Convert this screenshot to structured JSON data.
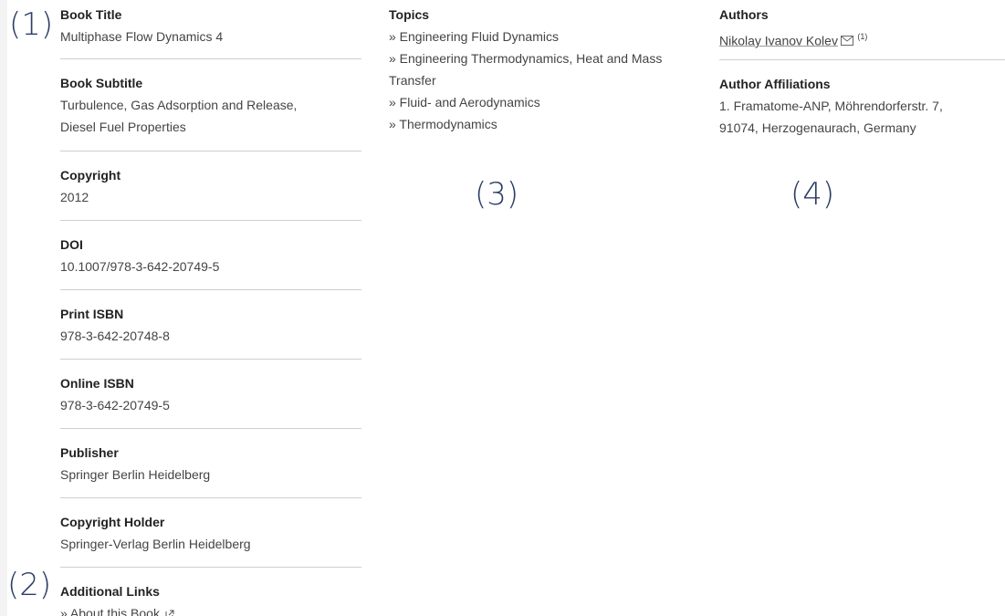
{
  "annotations": [
    "(1)",
    "(2)",
    "(3)",
    "(4)"
  ],
  "left": {
    "fields": [
      {
        "label": "Book Title",
        "value": "Multiphase Flow Dynamics 4"
      },
      {
        "label": "Book Subtitle",
        "value": "Turbulence, Gas Adsorption and Release, Diesel Fuel Properties"
      },
      {
        "label": "Copyright",
        "value": "2012"
      },
      {
        "label": "DOI",
        "value": "10.1007/978-3-642-20749-5"
      },
      {
        "label": "Print ISBN",
        "value": "978-3-642-20748-8"
      },
      {
        "label": "Online ISBN",
        "value": "978-3-642-20749-5"
      },
      {
        "label": "Publisher",
        "value": "Springer Berlin Heidelberg"
      },
      {
        "label": "Copyright Holder",
        "value": "Springer-Verlag Berlin Heidelberg"
      }
    ],
    "additional_links": {
      "label": "Additional Links",
      "items": [
        "» About this Book"
      ]
    }
  },
  "topics": {
    "label": "Topics",
    "items": [
      "» Engineering Fluid Dynamics",
      "» Engineering Thermodynamics, Heat and Mass Transfer",
      "» Fluid- and Aerodynamics",
      "» Thermodynamics"
    ]
  },
  "authors": {
    "label": "Authors",
    "name": "Nikolay Ivanov Kolev",
    "affiliation_ref": "(1)",
    "icon": "mail-icon"
  },
  "affiliations": {
    "label": "Author Affiliations",
    "text": "1. Framatome-ANP, Möhrendorferstr. 7, 91074, Herzogenaurach, Germany"
  },
  "colors": {
    "annotation": "#2c3e66",
    "divider": "#cfcfcf"
  }
}
